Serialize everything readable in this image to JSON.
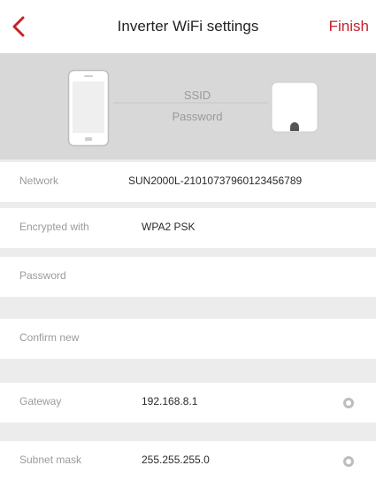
{
  "header": {
    "title": "Inverter WiFi settings",
    "finish_label": "Finish",
    "back_icon": "chevron-left-icon",
    "accent_color": "#c8202a"
  },
  "banner": {
    "ssid_label": "SSID",
    "password_label": "Password",
    "phone_icon": "smartphone-icon",
    "router_icon": "router-icon"
  },
  "form": {
    "network_label": "Network",
    "network_value": "SUN2000L-21010737960123456789",
    "encryption_label": "Encrypted with",
    "encryption_value": "WPA2 PSK",
    "password_label": "Password",
    "password_value": "",
    "confirm_label": "Confirm new",
    "confirm_value": "",
    "gateway_label": "Gateway",
    "gateway_value": "192.168.8.1",
    "subnet_label": "Subnet mask",
    "subnet_value": "255.255.255.0",
    "clear_icon": "clear-icon"
  }
}
